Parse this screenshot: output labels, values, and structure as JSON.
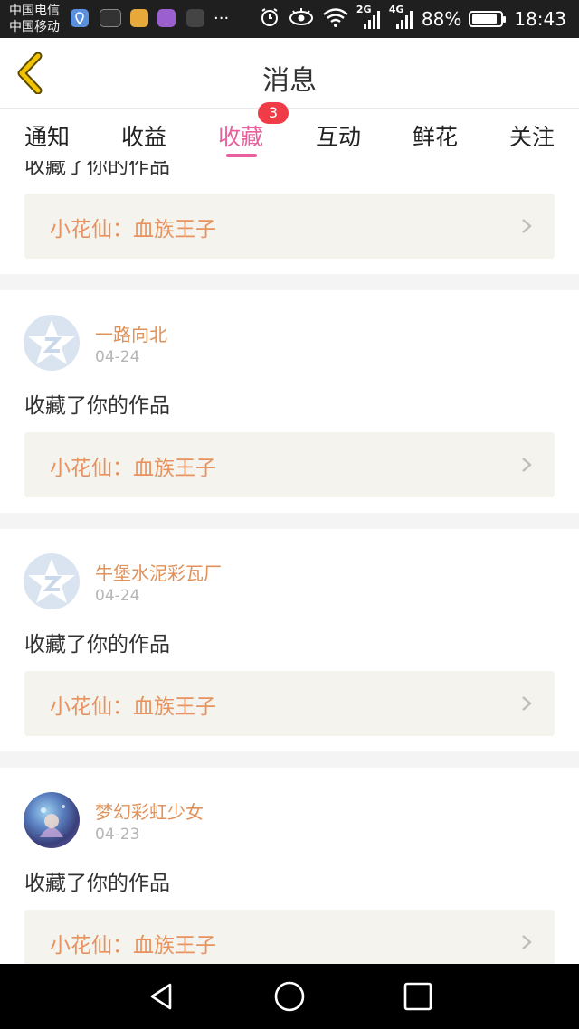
{
  "status_bar": {
    "carrier_1": "中国电信",
    "carrier_2": "中国移动",
    "more": "···",
    "net_2g": "2G",
    "net_4g": "4G",
    "battery": "88%",
    "battery_level": 0.88,
    "time": "18:43"
  },
  "header": {
    "title": "消息",
    "back_icon": "chevron-left-icon"
  },
  "tabs": [
    {
      "label": "通知",
      "active": false
    },
    {
      "label": "收益",
      "active": false
    },
    {
      "label": "收藏",
      "active": true,
      "badge": "3"
    },
    {
      "label": "互动",
      "active": false
    },
    {
      "label": "鲜花",
      "active": false
    },
    {
      "label": "关注",
      "active": false
    }
  ],
  "feed": {
    "partial_top": {
      "action": "收藏了你的作品",
      "work": "小花仙：血族王子"
    },
    "items": [
      {
        "user": "一路向北",
        "date": "04-24",
        "action": "收藏了你的作品",
        "work": "小花仙：血族王子",
        "avatar": "default-avatar"
      },
      {
        "user": "牛堡水泥彩瓦厂",
        "date": "04-24",
        "action": "收藏了你的作品",
        "work": "小花仙：血族王子",
        "avatar": "default-avatar"
      },
      {
        "user": "梦幻彩虹少女",
        "date": "04-23",
        "action": "收藏了你的作品",
        "work": "小花仙：血族王子",
        "avatar": "photo-avatar"
      }
    ]
  },
  "colors": {
    "accent_pink": "#e8609e",
    "username_orange": "#e0925a",
    "work_orange": "#e8935f",
    "badge_red": "#f03c47",
    "back_yellow": "#f2c300"
  }
}
